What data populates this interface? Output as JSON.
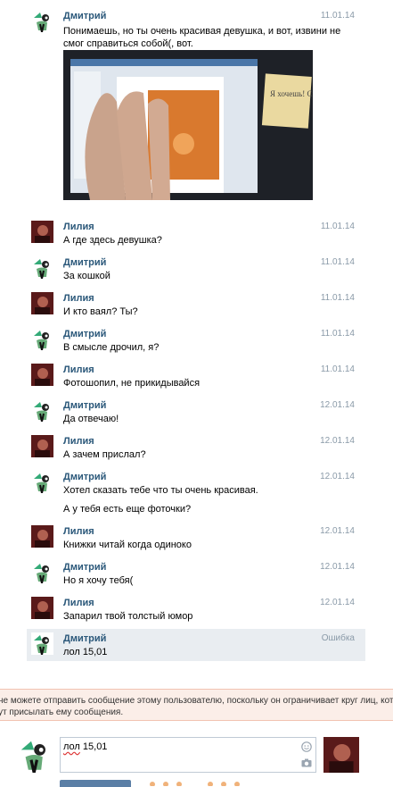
{
  "messages": [
    {
      "author": "Дмитрий",
      "avatar": "dmitry",
      "date": "11.01.14",
      "lines": [
        "Понимаешь, но ты очень красивая девушка, и вот, извини не",
        "смог справиться собой(, вот."
      ],
      "has_photo": true,
      "photo": {
        "note_text": "Я хочешь! Спасибо!"
      }
    },
    {
      "author": "Лилия",
      "avatar": "liliya",
      "date": "11.01.14",
      "lines": [
        "А где здесь девушка?"
      ]
    },
    {
      "author": "Дмитрий",
      "avatar": "dmitry",
      "date": "11.01.14",
      "lines": [
        "За кошкой"
      ]
    },
    {
      "author": "Лилия",
      "avatar": "liliya",
      "date": "11.01.14",
      "lines": [
        "И кто ваял? Ты?"
      ]
    },
    {
      "author": "Дмитрий",
      "avatar": "dmitry",
      "date": "11.01.14",
      "lines": [
        "В смысле дрочил, я?"
      ]
    },
    {
      "author": "Лилия",
      "avatar": "liliya",
      "date": "11.01.14",
      "lines": [
        "Фотошопил, не прикидывайся"
      ]
    },
    {
      "author": "Дмитрий",
      "avatar": "dmitry",
      "date": "12.01.14",
      "lines": [
        "Да отвечаю!"
      ]
    },
    {
      "author": "Лилия",
      "avatar": "liliya",
      "date": "12.01.14",
      "lines": [
        "А зачем прислал?"
      ]
    },
    {
      "author": "Дмитрий",
      "avatar": "dmitry",
      "date": "12.01.14",
      "lines": [
        "Хотел сказать тебе что ты очень красивая.",
        "А у тебя есть еще фоточки?"
      ]
    },
    {
      "author": "Лилия",
      "avatar": "liliya",
      "date": "12.01.14",
      "lines": [
        "Книжки читай когда одиноко"
      ]
    },
    {
      "author": "Дмитрий",
      "avatar": "dmitry",
      "date": "12.01.14",
      "lines": [
        "Но я хочу тебя("
      ]
    },
    {
      "author": "Лилия",
      "avatar": "liliya",
      "date": "12.01.14",
      "lines": [
        "Запарил твой толстый юмор"
      ]
    },
    {
      "author": "Дмитрий",
      "avatar": "dmitry",
      "date": "Ошибка",
      "lines": [
        "лол 15,01"
      ],
      "error": true
    }
  ],
  "notice": {
    "line1": "не можете отправить сообщение этому пользователю, поскольку он ограничивает круг лиц, котор",
    "line2": "ут присылать ему сообщения."
  },
  "composer": {
    "value_underlined": "лол",
    "value_rest": " 15,01",
    "icons": [
      "smile-icon",
      "camera-icon"
    ]
  },
  "colors": {
    "author": "#2b587a",
    "date": "#8a9aa8",
    "error_bg": "#e9edf1",
    "notice_bg": "#fbeee8"
  }
}
